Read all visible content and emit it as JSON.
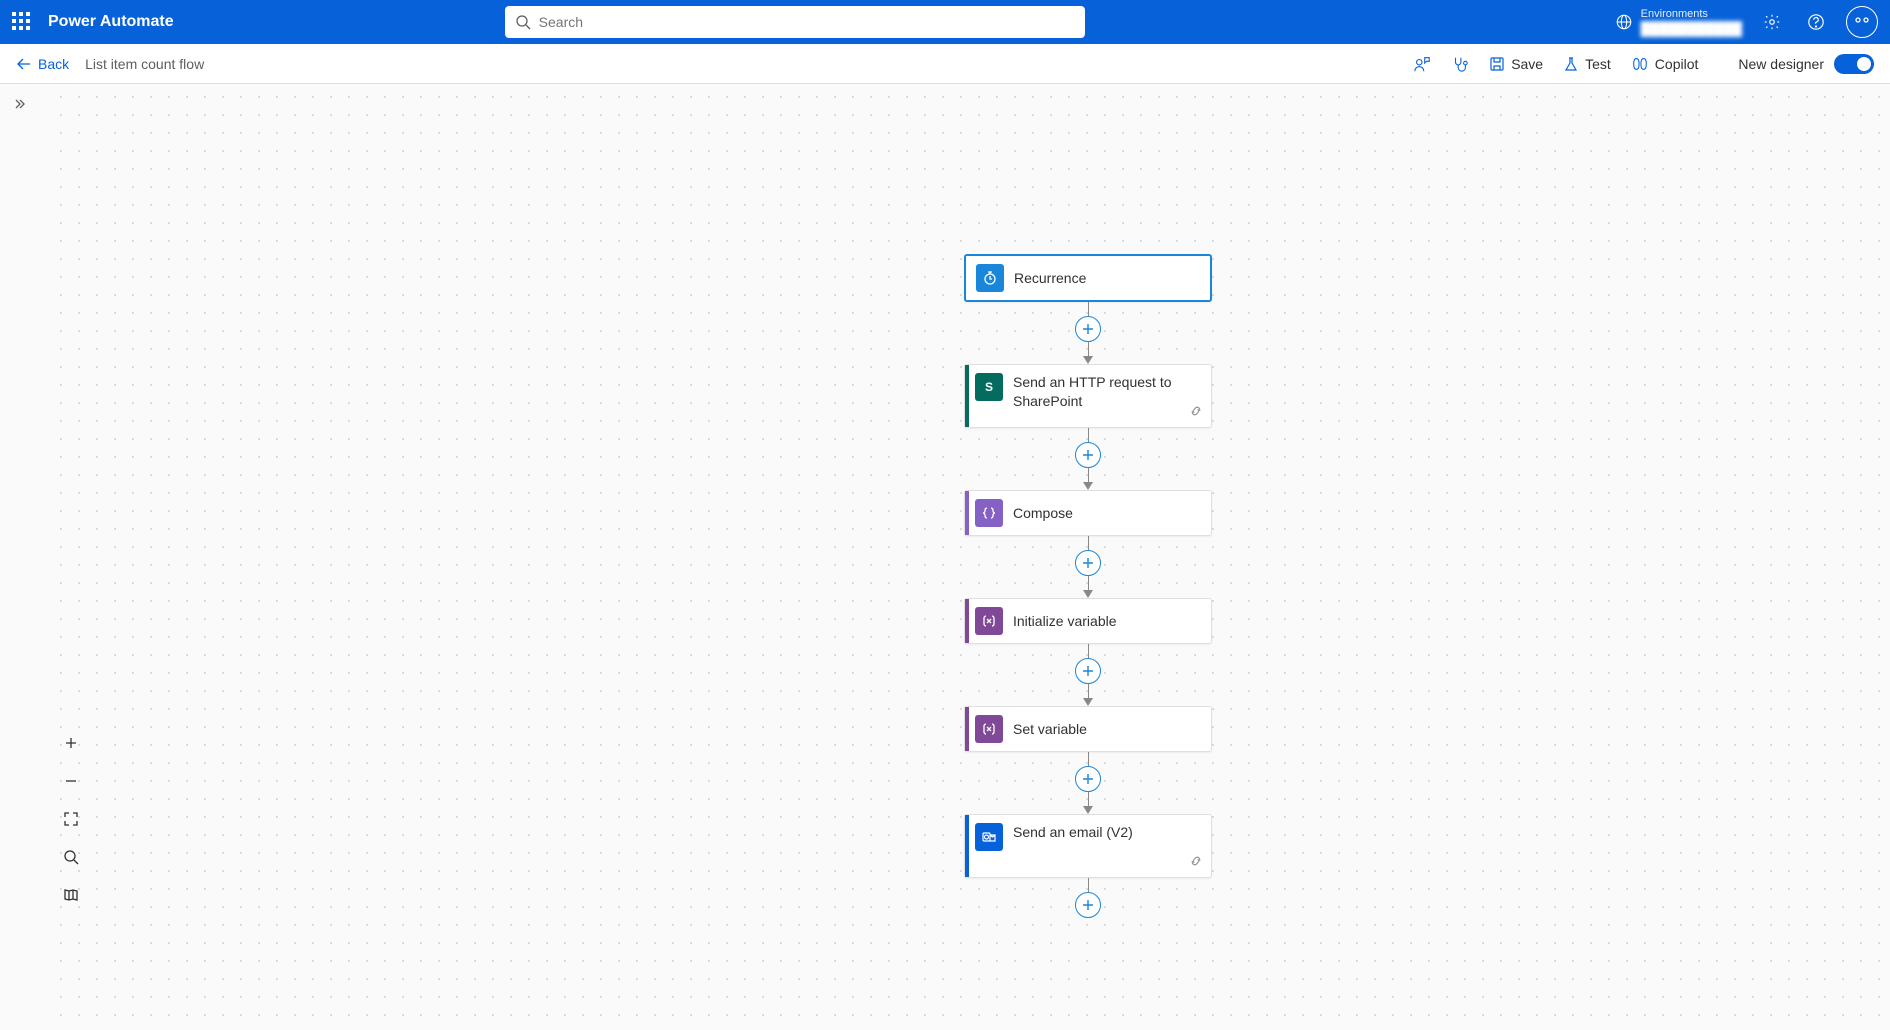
{
  "header": {
    "app_name": "Power Automate",
    "search_placeholder": "Search",
    "environments_label": "Environments",
    "environment_name": "███████████"
  },
  "subheader": {
    "back_label": "Back",
    "flow_name": "List item count flow",
    "save_label": "Save",
    "test_label": "Test",
    "copilot_label": "Copilot",
    "new_designer_label": "New designer"
  },
  "flow": {
    "nodes": [
      {
        "id": "recurrence",
        "label": "Recurrence",
        "accent": "acc-blue",
        "icon": "ic-blue",
        "icon_glyph": "clock",
        "selected": true
      },
      {
        "id": "http-sharepoint",
        "label": "Send an HTTP request to SharePoint",
        "accent": "acc-teal",
        "icon": "ic-teal",
        "icon_glyph": "S",
        "has_link": true,
        "tall": true
      },
      {
        "id": "compose",
        "label": "Compose",
        "accent": "acc-purple",
        "icon": "ic-purple",
        "icon_glyph": "braces"
      },
      {
        "id": "init-var",
        "label": "Initialize variable",
        "accent": "acc-purple2",
        "icon": "ic-purple2",
        "icon_glyph": "xvar"
      },
      {
        "id": "set-var",
        "label": "Set variable",
        "accent": "acc-purple2",
        "icon": "ic-purple2",
        "icon_glyph": "xvar"
      },
      {
        "id": "send-email",
        "label": "Send an email (V2)",
        "accent": "acc-outlook",
        "icon": "ic-outlook",
        "icon_glyph": "outlook",
        "has_link": true,
        "tall": true
      }
    ]
  }
}
